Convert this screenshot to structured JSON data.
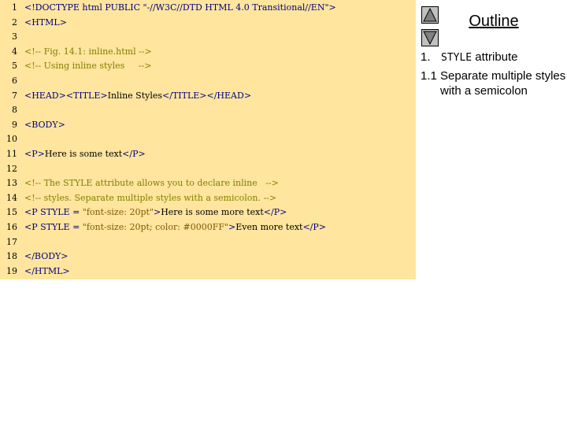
{
  "code_lines": [
    {
      "ln": "1",
      "tokens": [
        {
          "t": "<!DOCTYPE html PUBLIC \"-//W3C//DTD HTML 4.0 Transitional//EN\">",
          "c": "tag"
        }
      ]
    },
    {
      "ln": "2",
      "tokens": [
        {
          "t": "<HTML>",
          "c": "tag"
        }
      ]
    },
    {
      "ln": "3",
      "tokens": []
    },
    {
      "ln": "4",
      "tokens": [
        {
          "t": "<!-- Fig. 14.1: inline.html -->",
          "c": "comment"
        }
      ]
    },
    {
      "ln": "5",
      "tokens": [
        {
          "t": "<!-- Using inline styles     -->",
          "c": "comment"
        }
      ]
    },
    {
      "ln": "6",
      "tokens": []
    },
    {
      "ln": "7",
      "tokens": [
        {
          "t": "<HEAD><TITLE>",
          "c": "tag"
        },
        {
          "t": "Inline Styles",
          "c": "text"
        },
        {
          "t": "</TITLE></HEAD>",
          "c": "tag"
        }
      ]
    },
    {
      "ln": "8",
      "tokens": []
    },
    {
      "ln": "9",
      "tokens": [
        {
          "t": "<BODY>",
          "c": "tag"
        }
      ]
    },
    {
      "ln": "10",
      "tokens": []
    },
    {
      "ln": "11",
      "tokens": [
        {
          "t": "<P>",
          "c": "tag"
        },
        {
          "t": "Here is some text",
          "c": "text"
        },
        {
          "t": "</P>",
          "c": "tag"
        }
      ]
    },
    {
      "ln": "12",
      "tokens": []
    },
    {
      "ln": "13",
      "tokens": [
        {
          "t": "<!-- The STYLE attribute allows you to declare inline   -->",
          "c": "comment"
        }
      ]
    },
    {
      "ln": "14",
      "tokens": [
        {
          "t": "<!-- styles. Separate multiple styles with a semicolon. -->",
          "c": "comment"
        }
      ]
    },
    {
      "ln": "15",
      "tokens": [
        {
          "t": "<P STYLE = ",
          "c": "tag"
        },
        {
          "t": "\"font-size: 20pt\"",
          "c": "str"
        },
        {
          "t": ">",
          "c": "tag"
        },
        {
          "t": "Here is some more text",
          "c": "text"
        },
        {
          "t": "</P>",
          "c": "tag"
        }
      ]
    },
    {
      "ln": "16",
      "tokens": [
        {
          "t": "<P STYLE = ",
          "c": "tag"
        },
        {
          "t": "\"font-size: 20pt; color: #0000FF\"",
          "c": "str"
        },
        {
          "t": ">",
          "c": "tag"
        },
        {
          "t": "Even more text",
          "c": "text"
        },
        {
          "t": "</P>",
          "c": "tag"
        }
      ]
    },
    {
      "ln": "17",
      "tokens": []
    },
    {
      "ln": "18",
      "tokens": [
        {
          "t": "</BODY>",
          "c": "tag"
        }
      ]
    },
    {
      "ln": "19",
      "tokens": [
        {
          "t": "</HTML>",
          "c": "tag"
        }
      ]
    }
  ],
  "nav": {
    "up_icon": "triangle-up-icon",
    "down_icon": "triangle-down-icon"
  },
  "outline": {
    "title": "Outline",
    "item1": {
      "num": "1.",
      "code": "STYLE",
      "text": " attribute"
    },
    "item2": {
      "num": "1.1",
      "text": "Separate multiple styles with a semicolon"
    }
  },
  "colors": {
    "panel_bg": "#ffe59e",
    "tag": "#000080",
    "comment": "#808000",
    "string": "#7f5a00",
    "text": "#000000"
  }
}
